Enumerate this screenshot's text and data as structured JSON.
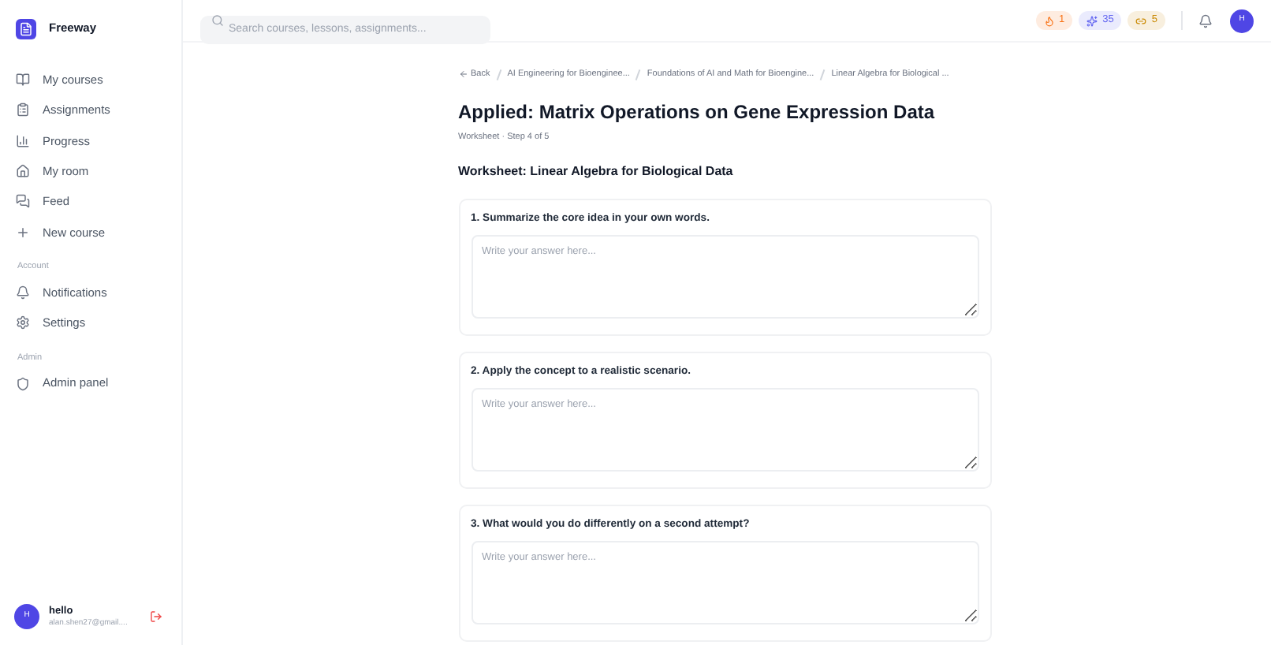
{
  "brand": {
    "name": "Freeway"
  },
  "sidebar": {
    "sections": [
      {
        "items": [
          {
            "label": "My courses"
          },
          {
            "label": "Assignments"
          },
          {
            "label": "Progress"
          },
          {
            "label": "My room"
          },
          {
            "label": "Feed"
          },
          {
            "label": "New course"
          }
        ]
      },
      {
        "heading": "Account",
        "items": [
          {
            "label": "Notifications"
          },
          {
            "label": "Settings"
          }
        ]
      },
      {
        "heading": "Admin",
        "items": [
          {
            "label": "Admin panel"
          }
        ]
      }
    ]
  },
  "user": {
    "initial": "H",
    "name": "hello",
    "email": "alan.shen27@gmail...."
  },
  "search": {
    "placeholder": "Search courses, lessons, assignments..."
  },
  "stats": [
    {
      "value": "1",
      "color": "#f97316"
    },
    {
      "value": "35",
      "color": "#6366f1"
    },
    {
      "value": "5",
      "color": "#ca8a04"
    }
  ],
  "avatar": {
    "initial": "H"
  },
  "breadcrumbs": {
    "back": "Back",
    "items": [
      "AI Engineering for Bioenginee...",
      "Foundations of AI and Math for Bioengine...",
      "Linear Algebra for Biological ..."
    ]
  },
  "page": {
    "title": "Applied: Matrix Operations on Gene Expression Data",
    "subtitle": "Worksheet · Step 4 of 5",
    "section_title": "Worksheet: Linear Algebra for Biological Data"
  },
  "questions": [
    {
      "prompt": "1. Summarize the core idea in your own words.",
      "placeholder": "Write your answer here..."
    },
    {
      "prompt": "2. Apply the concept to a realistic scenario.",
      "placeholder": "Write your answer here..."
    },
    {
      "prompt": "3. What would you do differently on a second attempt?",
      "placeholder": "Write your answer here..."
    }
  ]
}
